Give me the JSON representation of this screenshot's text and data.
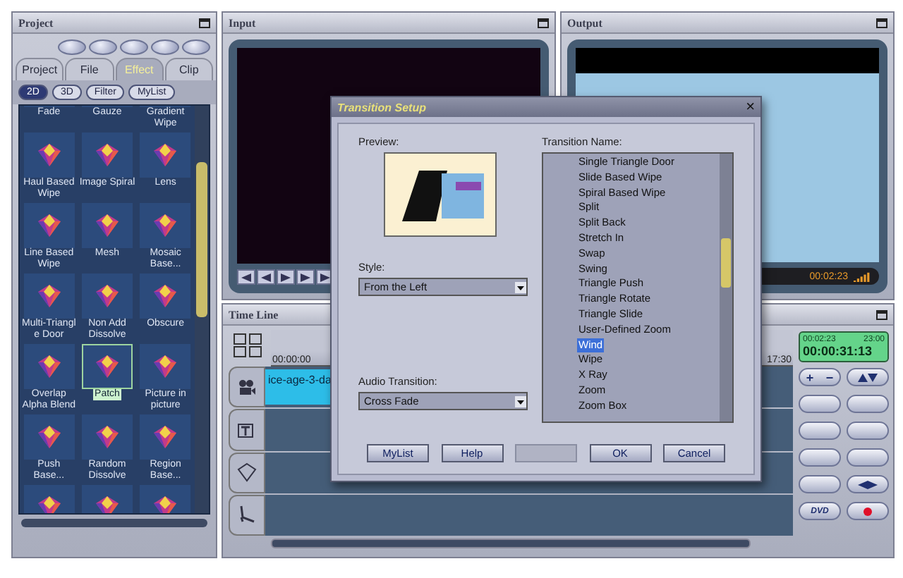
{
  "project_panel": {
    "title": "Project",
    "tabs": [
      {
        "label": "Project",
        "selected": false
      },
      {
        "label": "File",
        "selected": false
      },
      {
        "label": "Effect",
        "selected": true
      },
      {
        "label": "Clip",
        "selected": false
      }
    ],
    "filters": [
      {
        "label": "2D",
        "selected": true
      },
      {
        "label": "3D",
        "selected": false
      },
      {
        "label": "Filter",
        "selected": false
      },
      {
        "label": "MyList",
        "selected": false
      }
    ],
    "effects": [
      {
        "name": "Fade",
        "selected": false
      },
      {
        "name": "Gauze",
        "selected": false
      },
      {
        "name": "Gradient Wipe",
        "selected": false
      },
      {
        "name": "Haul Based Wipe",
        "selected": false
      },
      {
        "name": "Image Spiral",
        "selected": false
      },
      {
        "name": "Lens",
        "selected": false
      },
      {
        "name": "Line Based Wipe",
        "selected": false
      },
      {
        "name": "Mesh",
        "selected": false
      },
      {
        "name": "Mosaic Base...",
        "selected": false
      },
      {
        "name": "Multi-Triangl e Door",
        "selected": false
      },
      {
        "name": "Non Add Dissolve",
        "selected": false
      },
      {
        "name": "Obscure",
        "selected": false
      },
      {
        "name": "Overlap Alpha Blend",
        "selected": false
      },
      {
        "name": "Patch",
        "selected": true
      },
      {
        "name": "Picture in picture",
        "selected": false
      },
      {
        "name": "Push Base...",
        "selected": false
      },
      {
        "name": "Random Dissolve",
        "selected": false
      },
      {
        "name": "Region Base...",
        "selected": false
      },
      {
        "selected": false
      },
      {
        "selected": false
      },
      {
        "selected": false
      }
    ]
  },
  "input_panel": {
    "title": "Input"
  },
  "output_panel": {
    "title": "Output",
    "timecode": "00:02:23"
  },
  "timeline": {
    "title": "Time Line",
    "ruler_start": "00:00:00",
    "ruler_end": "17:30",
    "clip": "ice-age-3-da"
  },
  "lcd": {
    "time_a": "00:02:23",
    "time_b": "23:00",
    "main": "00:00:31:13"
  },
  "controls": {
    "plus": "+",
    "minus": "−",
    "dvd": "DVD"
  },
  "dialog": {
    "title": "Transition Setup",
    "close": "×",
    "preview_label": "Preview:",
    "style_label": "Style:",
    "style_value": "From the Left",
    "audio_label": "Audio Transition:",
    "audio_value": "Cross Fade",
    "list_label": "Transition Name:",
    "transitions": [
      {
        "name": "Single Triangle Door",
        "selected": false
      },
      {
        "name": "Slide Based Wipe",
        "selected": false
      },
      {
        "name": "Spiral Based Wipe",
        "selected": false
      },
      {
        "name": "Split",
        "selected": false
      },
      {
        "name": "Split Back",
        "selected": false
      },
      {
        "name": "Stretch In",
        "selected": false
      },
      {
        "name": "Swap",
        "selected": false
      },
      {
        "name": "Swing",
        "selected": false
      },
      {
        "name": "Triangle Push",
        "selected": false
      },
      {
        "name": "Triangle Rotate",
        "selected": false
      },
      {
        "name": "Triangle Slide",
        "selected": false
      },
      {
        "name": "User-Defined Zoom",
        "selected": false
      },
      {
        "name": "Wind",
        "selected": true
      },
      {
        "name": "Wipe",
        "selected": false
      },
      {
        "name": "X Ray",
        "selected": false
      },
      {
        "name": "Zoom",
        "selected": false
      },
      {
        "name": "Zoom Box",
        "selected": false
      }
    ],
    "buttons": [
      {
        "label": "MyList",
        "disabled": false
      },
      {
        "label": "Help",
        "disabled": false
      },
      {
        "disabled": true
      },
      {
        "label": "OK",
        "disabled": false
      },
      {
        "label": "Cancel",
        "disabled": false
      }
    ]
  }
}
